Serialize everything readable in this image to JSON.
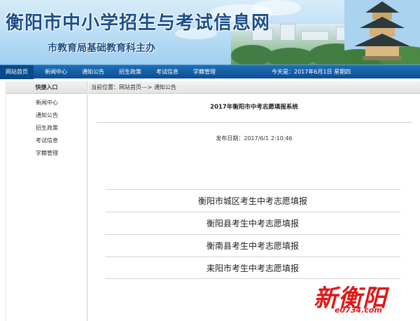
{
  "header": {
    "site_title": "衡阳市中小学招生与考试信息网",
    "site_subtitle": "市教育局基础教育科主办"
  },
  "nav": {
    "items": [
      "网站首页",
      "新闻中心",
      "通知公告",
      "招生政策",
      "考试信息",
      "学籍管理"
    ],
    "date_text": "今天是：2017年6月1日 星期四"
  },
  "sidebar": {
    "heading": "快捷入口",
    "items": [
      "新闻中心",
      "通知公告",
      "招生政策",
      "考试信息",
      "学籍管理"
    ]
  },
  "main": {
    "breadcrumb": "当前位置：网站首页---> 通知公告",
    "title": "2017年衡阳市中考志愿填报系统",
    "publish_date": "发布日期：2017/6/1 2:10:46",
    "links": [
      "衡阳市城区考生中考志愿填报",
      "衡阳县考生中考志愿填报",
      "衡南县考生中考志愿填报",
      "耒阳市考生中考志愿填报"
    ]
  },
  "watermark": {
    "brand": "新衡阳",
    "url": "e0734.com"
  },
  "colors": {
    "nav_bg": "#0d4f92",
    "title_blue": "#1c4f8c",
    "watermark_red": "#e01818"
  }
}
